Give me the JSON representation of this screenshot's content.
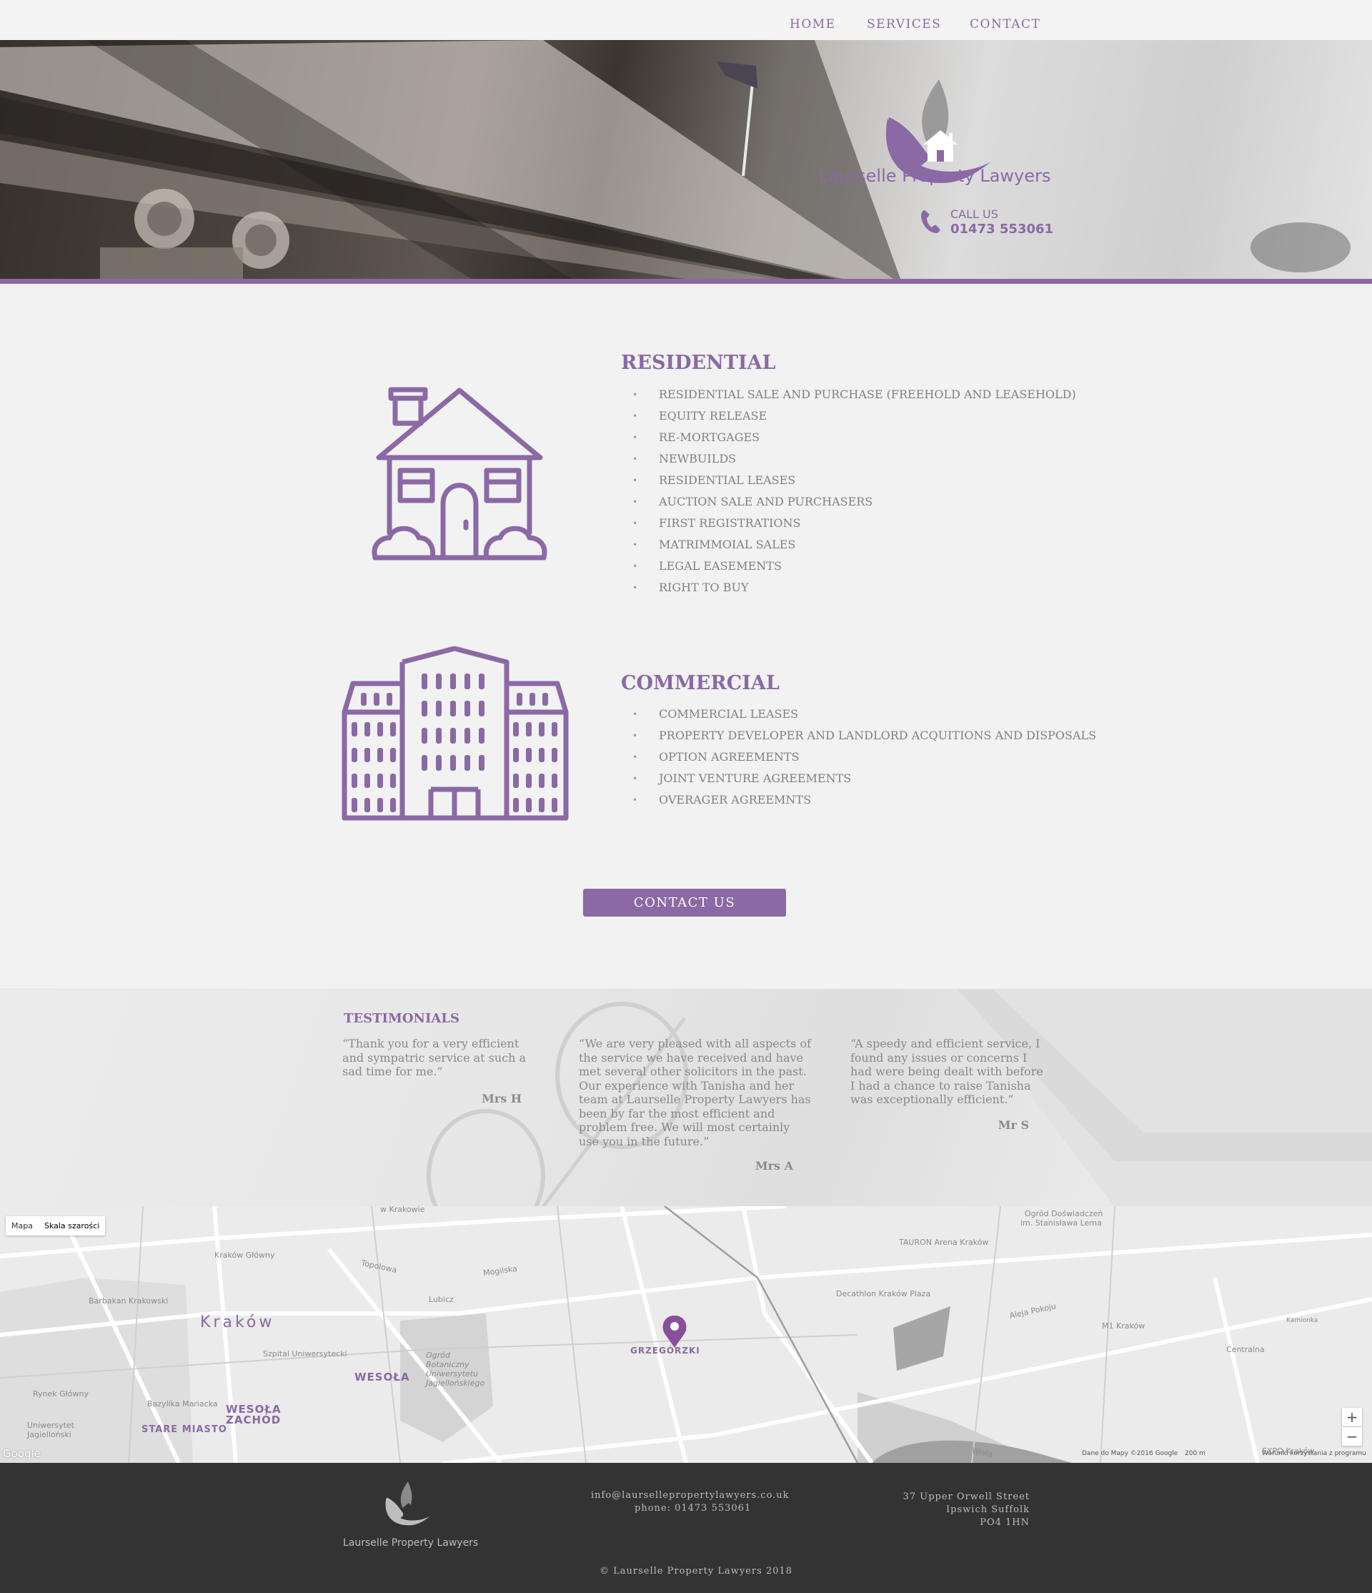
{
  "nav": {
    "home": "HOME",
    "services": "SERVICES",
    "contact": "CONTACT"
  },
  "header": {
    "company_name": "Laurselle Property Lawyers",
    "call_label": "CALL US",
    "phone": "01473 553061"
  },
  "residential": {
    "title": "RESIDENTIAL",
    "items": [
      "RESIDENTIAL SALE AND PURCHASE (FREEHOLD AND LEASEHOLD)",
      "EQUITY RELEASE",
      "RE-MORTGAGES",
      "NEWBUILDS",
      "RESIDENTIAL LEASES",
      "AUCTION SALE AND PURCHASERS",
      "FIRST REGISTRATIONS",
      "MATRIMMOIAL SALES",
      "LEGAL EASEMENTS",
      "RIGHT TO BUY"
    ]
  },
  "commercial": {
    "title": "COMMERCIAL",
    "items": [
      "COMMERCIAL LEASES",
      "PROPERTY DEVELOPER AND LANDLORD ACQUITIONS AND DISPOSALS",
      "OPTION AGREEMENTS",
      "JOINT VENTURE AGREEMENTS",
      "OVERAGER AGREEMNTS"
    ]
  },
  "contact_button": "CONTACT US",
  "testimonials": {
    "title": "TESTIMONIALS",
    "items": [
      {
        "lines": [
          "“Thank you for a very efficient",
          "and sympatric service at such a",
          "sad time for me.”"
        ],
        "author": "Mrs H"
      },
      {
        "lines": [
          "“We are very pleased with all aspects of",
          "the service we have received and have",
          "met several other solicitors in the past.",
          "Our experience with Tanisha and her",
          "team at Laurselle Property Lawyers has",
          "been by far the most efficient and",
          "problem free. We will most certainly",
          "use you in the future.”"
        ],
        "author": "Mrs A"
      },
      {
        "lines": [
          "“A speedy and efficient service, I",
          "found any issues or concerns I",
          "had were being dealt with before",
          "I had a chance to raise Tanisha",
          "was exceptionally efficient.”"
        ],
        "author": "Mr S"
      }
    ]
  },
  "map": {
    "btn_map": "Mapa",
    "btn_gray": "Skala szarości",
    "zoom_in": "+",
    "zoom_out": "−",
    "pin_label": "GRZEGÓRZKI",
    "labels": {
      "krakow": "Kraków",
      "wesola": "WESOŁA",
      "wesola_zachod_1": "WESOŁA",
      "wesola_zachod_2": "ZACHÓD",
      "stare_miasto": "STARE MIASTO",
      "tauron": "TAURON Arena Kraków",
      "decathlon": "Decathlon Kraków Plaza",
      "m1": "M1 Kraków",
      "krakow_glowny": "Kraków Główny",
      "barbakan": "Barbakan Krakowski",
      "rynek": "Rynek Główny",
      "bazylika": "Bazylika Mariacka",
      "ogrod": "Ogród Doświadczeń",
      "ogrod2": "im. Stanisława Lema",
      "centralna": "Centralna",
      "kamionka": "Kamionka",
      "aleja_pokoju": "Aleja Pokoju",
      "mogilska": "Mogilska",
      "lubicz": "Lubicz",
      "topolowa": "Topolowa",
      "szpital": "Szpital Uniwersytecki",
      "expo": "EXPO Kraków",
      "wisla": "Wisła",
      "wkrakowie": "w Krakowie",
      "botaniczny": "Ogród Botaniczny Uniwersytetu Jagiellońskiego",
      "uniwersytet": "Uniwersytet Jagielloński"
    },
    "attribution": "Dane do Mapy ©2016 Google",
    "scale": "200 m",
    "terms": "Warunki korzystania z programu",
    "google": "Google"
  },
  "footer": {
    "company_name": "Laurselle Property Lawyers",
    "email": "info@laursellepropertylawyers.co.uk",
    "phone": "phone: 01473 553061",
    "address1": "37 Upper Orwell Street",
    "address2": "Ipswich Suffolk",
    "address3": "PO4 1HN",
    "copyright": "© Laurselle Property Lawyers 2018"
  }
}
